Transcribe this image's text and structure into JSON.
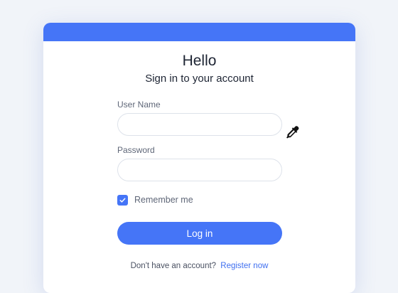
{
  "card": {
    "title": "Hello",
    "subtitle": "Sign in to your account"
  },
  "form": {
    "username_label": "User Name",
    "username_value": "",
    "password_label": "Password",
    "password_value": "",
    "remember_label": "Remember me",
    "remember_checked": true,
    "login_label": "Log in"
  },
  "footer": {
    "prompt": "Don't have an account?",
    "register_label": "Register now"
  },
  "colors": {
    "accent": "#4575f7",
    "background": "#f1f4f9",
    "card": "#ffffff",
    "text": "#1d2433",
    "muted": "#5f6778"
  },
  "icons": {
    "field_tool": "eyedropper-icon",
    "checkbox_mark": "checkmark-icon"
  }
}
